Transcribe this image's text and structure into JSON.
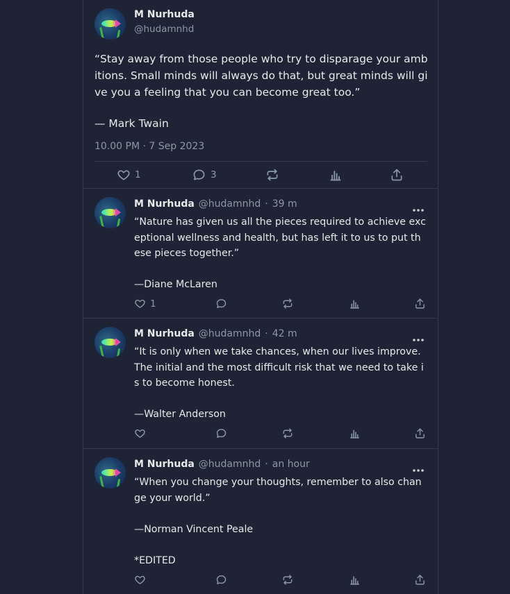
{
  "main_post": {
    "author_name": "M Nurhuda",
    "author_handle": "@hudamnhd",
    "text": "“Stay away from those people who try to disparage your ambitions. Small minds will always do that, but great minds will give you a feeling that you can become great too.”",
    "attribution": " — Mark Twain",
    "timestamp": "10.00 PM · 7 Sep 2023",
    "actions": {
      "like_count": "1",
      "reply_count": "3"
    }
  },
  "replies": [
    {
      "author_name": "M Nurhuda",
      "author_handle": "@hudamnhd",
      "separator": "·",
      "time": "39 m",
      "text": "“Nature has given us all the pieces required to achieve exceptional wellness and health, but has left it to us to put these pieces together.”\n\n—Diane McLaren",
      "like_count": "1"
    },
    {
      "author_name": "M Nurhuda",
      "author_handle": "@hudamnhd",
      "separator": "·",
      "time": "42 m",
      "text": "“It is only when we take chances, when our lives improve. The initial and the most difficult risk that we need to take is to become honest.\n\n—Walter Anderson",
      "like_count": ""
    },
    {
      "author_name": "M Nurhuda",
      "author_handle": "@hudamnhd",
      "separator": "·",
      "time": "an hour",
      "text": "“When you change your thoughts, remember to also change your world.”\n\n—Norman Vincent Peale\n\n*EDITED",
      "like_count": ""
    }
  ],
  "icons": {
    "like": "heart-icon",
    "reply": "speech-bubble-icon",
    "repost": "repost-icon",
    "views": "bar-chart-icon",
    "share": "share-icon",
    "more": "more-horizontal-icon"
  },
  "colors": {
    "background": "#1e2435",
    "border": "#333b4c",
    "muted_text": "#8b98a5",
    "text": "#e7e9ea"
  }
}
